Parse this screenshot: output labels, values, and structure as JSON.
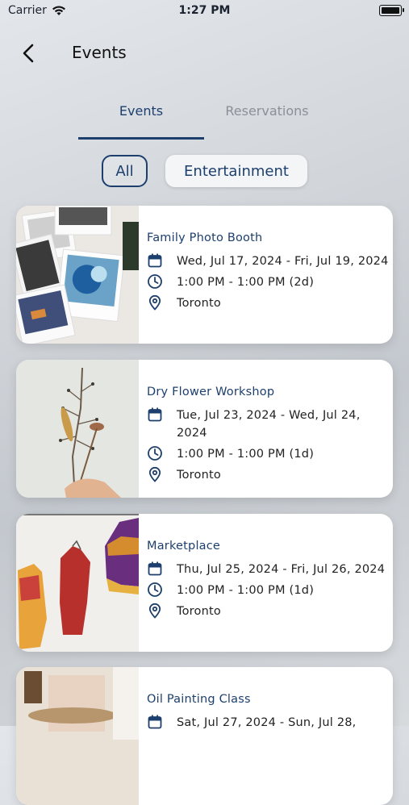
{
  "status": {
    "carrier": "Carrier",
    "time": "1:27 PM"
  },
  "nav": {
    "title": "Events"
  },
  "tabs": [
    {
      "label": "Events",
      "active": true
    },
    {
      "label": "Reservations",
      "active": false
    }
  ],
  "filters": [
    {
      "label": "All",
      "selected": true
    },
    {
      "label": "Entertainment",
      "selected": false
    }
  ],
  "events": [
    {
      "title": "Family Photo Booth",
      "date": "Wed, Jul 17, 2024 - Fri, Jul 19, 2024",
      "time": "1:00 PM - 1:00 PM (2d)",
      "location": "Toronto",
      "image": "polaroid-photos"
    },
    {
      "title": "Dry Flower Workshop",
      "date": "Tue, Jul 23, 2024 - Wed, Jul 24, 2024",
      "time": "1:00 PM - 1:00 PM (1d)",
      "location": "Toronto",
      "image": "dried-flower"
    },
    {
      "title": "Marketplace",
      "date": "Thu, Jul 25, 2024 - Fri, Jul 26, 2024",
      "time": "1:00 PM - 1:00 PM (1d)",
      "location": "Toronto",
      "image": "hanging-jackets"
    },
    {
      "title": "Oil Painting Class",
      "date": "Sat, Jul 27, 2024 - Sun, Jul 28,",
      "time": "",
      "location": "",
      "image": "painting-easel"
    }
  ],
  "colors": {
    "accent": "#1d3f6e",
    "inactive_tab": "#8a9098",
    "card_bg": "#ffffff"
  }
}
